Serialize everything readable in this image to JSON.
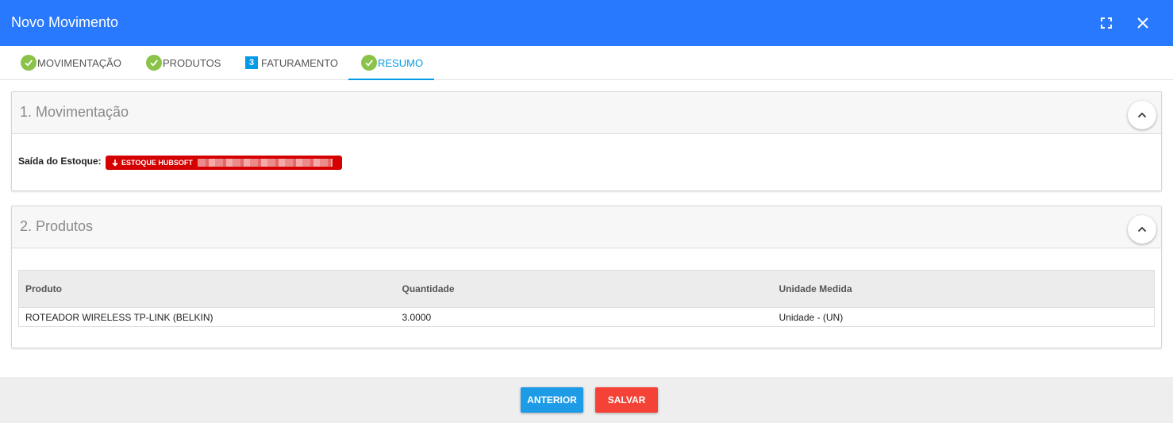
{
  "window": {
    "title": "Novo Movimento",
    "expand_icon": "fullscreen-icon",
    "close_icon": "close-icon"
  },
  "tabs": [
    {
      "label": "MOVIMENTAÇÃO",
      "status": "done"
    },
    {
      "label": "PRODUTOS",
      "status": "done"
    },
    {
      "label": "FATURAMENTO",
      "status": "number",
      "number": "3"
    },
    {
      "label": "RESUMO",
      "status": "done",
      "active": true
    }
  ],
  "section1": {
    "title": "1. Movimentação",
    "exit_label": "Saída do Estoque:",
    "stock_badge": "ESTOQUE HUBSOFT",
    "badge_color": "#d50000"
  },
  "section2": {
    "title": "2. Produtos",
    "columns": [
      "Produto",
      "Quantidade",
      "Unidade Medida"
    ],
    "rows": [
      [
        "ROTEADOR WIRELESS TP-LINK (BELKIN)",
        "3.0000",
        "Unidade - (UN)"
      ]
    ]
  },
  "footer": {
    "prev_label": "ANTERIOR",
    "save_label": "SALVAR",
    "prev_color": "#1e9be6",
    "save_color": "#f44336"
  },
  "colors": {
    "header": "#2979ff",
    "check": "#8bc34a",
    "active_tab": "#039be5"
  }
}
